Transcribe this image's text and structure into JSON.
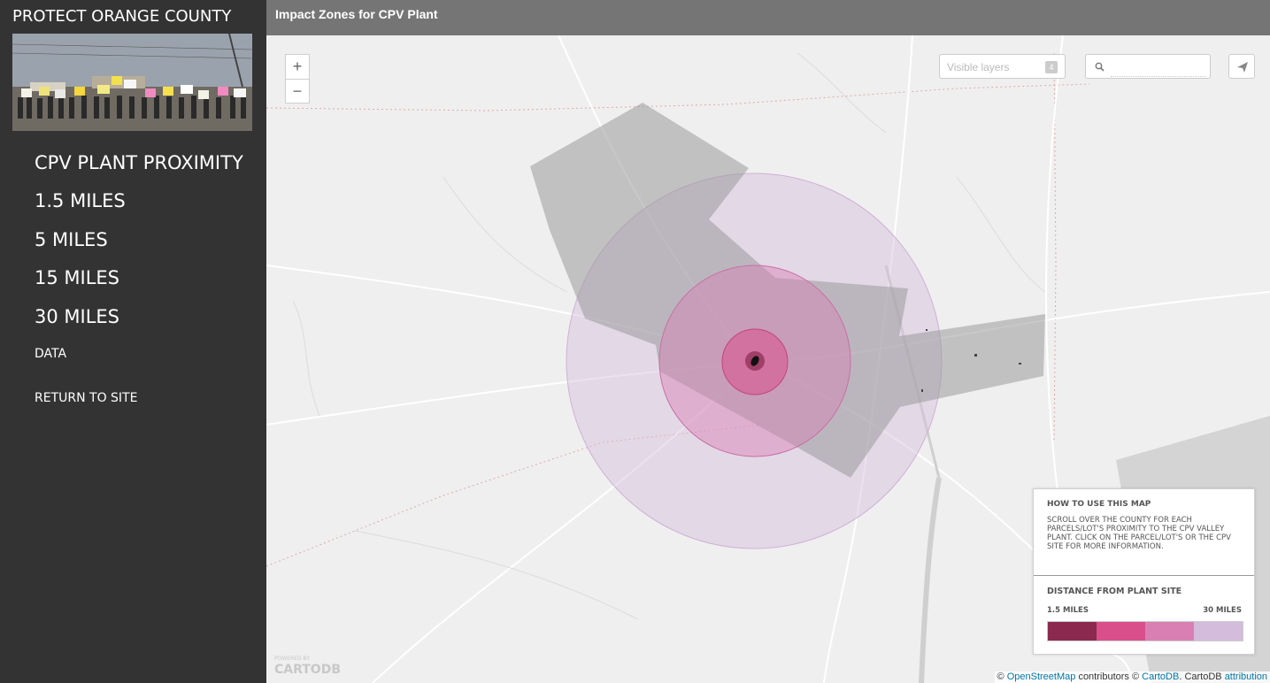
{
  "sidebar": {
    "title": "PROTECT ORANGE COUNTY",
    "nav": [
      {
        "label": "CPV PLANT PROXIMITY"
      },
      {
        "label": "1.5 MILES"
      },
      {
        "label": "5 MILES"
      },
      {
        "label": "15 MILES"
      },
      {
        "label": "30 MILES"
      },
      {
        "label": "DATA"
      },
      {
        "label": "RETURN TO SITE"
      }
    ]
  },
  "map": {
    "title": "Impact Zones for CPV Plant",
    "zoom_in": "+",
    "zoom_out": "−",
    "layers_label": "Visible layers",
    "layers_count": "4",
    "search_placeholder": "",
    "share_icon": "paper-plane-icon",
    "search_icon": "search-icon"
  },
  "legend": {
    "howto_title": "HOW TO USE THIS MAP",
    "howto_text": "SCROLL OVER THE COUNTY FOR EACH PARCELS/LOT'S PROXIMITY TO THE CPV VALLEY PLANT. CLICK ON THE PARCEL/LOT'S OR THE CPV SITE FOR MORE INFORMATION.",
    "distance_title": "DISTANCE FROM PLANT SITE",
    "min_label": "1.5 MILES",
    "max_label": "30 MILES",
    "colors": [
      "#8b2a4e",
      "#d84f8c",
      "#d97fb4",
      "#d4bcdc"
    ]
  },
  "branding": {
    "powered_by": "POWERED BY",
    "brand": "CARTODB"
  },
  "attribution": {
    "copyright1": "©",
    "osm": "OpenStreetMap",
    "contributors": "contributors ©",
    "cartodb": "CartoDB",
    "rest": ". CartoDB",
    "attribution_link": "attribution"
  }
}
